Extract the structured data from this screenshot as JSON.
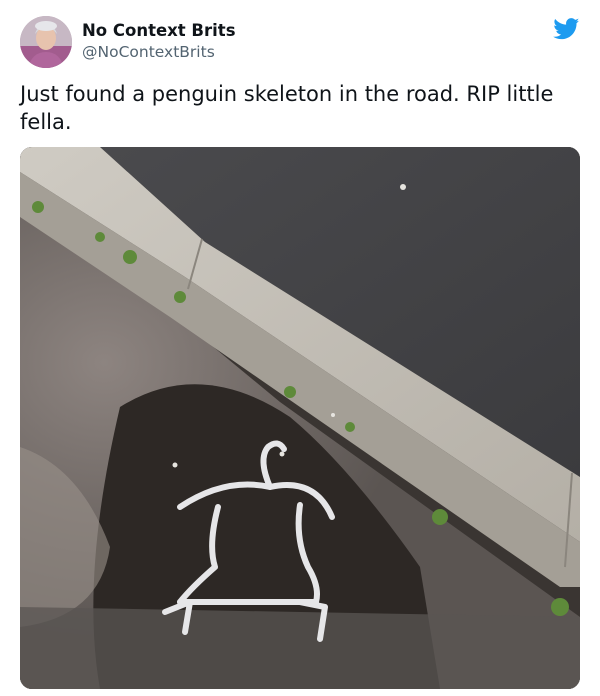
{
  "tweet": {
    "author": {
      "display_name": "No Context Brits",
      "handle": "@NoContextBrits",
      "avatar_icon": "avatar-photo"
    },
    "platform_icon": "twitter-bird-icon",
    "text": "Just found a penguin skeleton in the road. RIP little fella.",
    "photo": {
      "subject": "road-curb-with-hanger-photo"
    }
  },
  "colors": {
    "twitter_blue": "#1d9bf0",
    "text_primary": "#0f1419",
    "text_secondary": "#536471"
  }
}
